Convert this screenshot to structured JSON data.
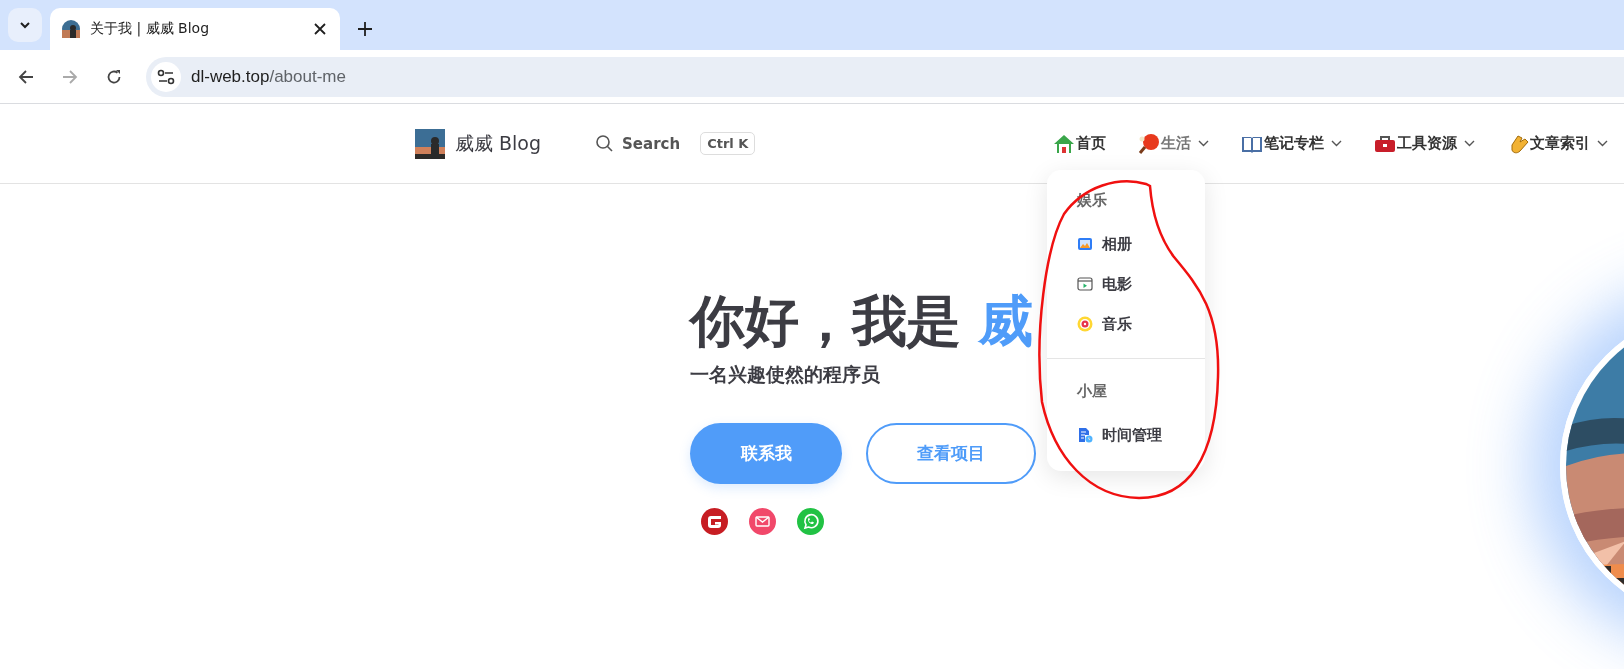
{
  "browser": {
    "tab": {
      "title": "关于我 | 威威 Blog",
      "selected": true
    },
    "address": {
      "host": "dl-web.top",
      "path": "/about-me"
    }
  },
  "header": {
    "site_name": "威威 Blog",
    "search": {
      "label": "Search",
      "shortcut": "Ctrl K"
    },
    "nav": [
      {
        "label": "首页",
        "kind": "home",
        "dropdown": false,
        "open": false
      },
      {
        "label": "生活",
        "kind": "paddle",
        "dropdown": true,
        "open": true
      },
      {
        "label": "笔记专栏",
        "kind": "book",
        "dropdown": true,
        "open": false
      },
      {
        "label": "工具资源",
        "kind": "toolbox",
        "dropdown": true,
        "open": false
      },
      {
        "label": "文章索引",
        "kind": "clap",
        "dropdown": true,
        "open": false
      }
    ]
  },
  "dropdown": {
    "groups": [
      {
        "title": "娱乐",
        "items": [
          {
            "label": "相册"
          },
          {
            "label": "电影",
            "kind": "film"
          },
          {
            "label": "音乐",
            "kind": "music"
          }
        ]
      },
      {
        "title": "小屋",
        "items": [
          {
            "label": "时间管理",
            "kind": "doc-clock"
          }
        ]
      }
    ]
  },
  "hero": {
    "greeting": "你好，",
    "intro": "我是",
    "name": "威",
    "subtitle": "一名兴趣使然的程序员",
    "buttons": [
      {
        "label": "联系我",
        "kind": "primary"
      },
      {
        "label": "查看项目",
        "kind": "outline"
      }
    ],
    "socials": [
      {
        "kind": "gitee"
      },
      {
        "kind": "mail"
      },
      {
        "kind": "whatsapp"
      }
    ]
  }
}
